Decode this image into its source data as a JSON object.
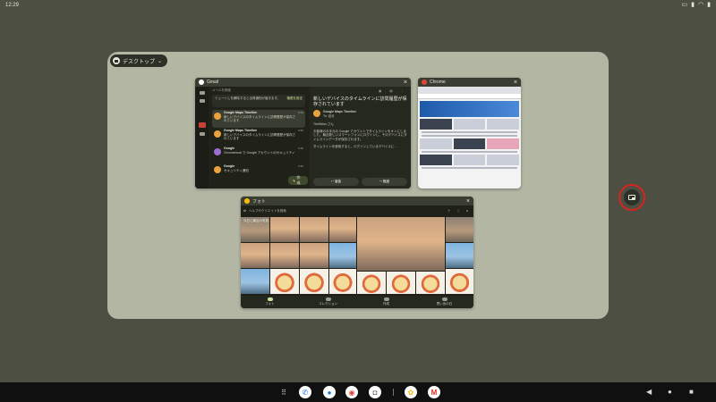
{
  "status_bar": {
    "time": "12:29",
    "icons": [
      "screen-record-icon",
      "battery-icon",
      "wifi-icon",
      "battery-level-icon"
    ]
  },
  "desk": {
    "label": "デスクトップ"
  },
  "windows": {
    "gmail": {
      "title": "Gmail",
      "search_hint": "メールを検索",
      "notice": "ミュートしを解除すると出荷通知が届きます。",
      "notice_action": "権限を設定",
      "items": [
        {
          "sender": "Google Maps Timeline",
          "snippet": "新しいデバイスのタイムラインに訪問履歴が保存されています",
          "time": "9:52",
          "color": "#e8a33a"
        },
        {
          "sender": "Google Maps Timeline",
          "snippet": "新しいデバイスのタイムラインに訪問履歴が保存されています",
          "time": "9:50",
          "color": "#e8a33a"
        },
        {
          "sender": "Google",
          "snippet": "Chromebook で Google アカウントのセキュリティ",
          "time": "9:48",
          "color": "#9b6fd2"
        },
        {
          "sender": "Google",
          "snippet": "セキュリティ通知",
          "time": "9:45",
          "color": "#e8a33a"
        }
      ],
      "compose": "作成",
      "subject": "新しいデバイスのタイムラインに訪問履歴が保存されています",
      "from": "Google Maps Timeline",
      "to": "To: 自分",
      "greeting": "TheWebs さん",
      "body1": "お客様のお手元の Google アカウントでタイムラインをオンにしました。最近新しいスマートフォンにログインし、そのデバイスにタイムラインデータが保存されます。",
      "body2": "タイムラインを使用すると、ログインしているデバイスに…",
      "reply": "返信",
      "forward": "転送"
    },
    "chrome": {
      "title": "Chrome"
    },
    "photos": {
      "title": "フォト",
      "search_hint": "ヘルプやクリエイトを検索",
      "date_label": "今日と最近の写真",
      "nav": [
        {
          "label": "フォト",
          "active": true
        },
        {
          "label": "コレクション",
          "active": false
        },
        {
          "label": "作成",
          "active": false
        },
        {
          "label": "思い出の日",
          "active": false
        }
      ]
    }
  },
  "taskbar": {
    "apps": [
      {
        "name": "launcher",
        "glyph": "⠿",
        "bg": "transparent",
        "fg": "#e6e6e6"
      },
      {
        "name": "phone",
        "glyph": "✆",
        "bg": "#ffffff",
        "fg": "#1a73e8"
      },
      {
        "name": "messages",
        "glyph": "●",
        "bg": "#ffffff",
        "fg": "#1a73e8"
      },
      {
        "name": "chrome",
        "glyph": "◉",
        "bg": "#ffffff",
        "fg": "#db4437"
      },
      {
        "name": "camera",
        "glyph": "◘",
        "bg": "#ffffff",
        "fg": "#5f6368"
      },
      {
        "name": "photos",
        "glyph": "✿",
        "bg": "#ffffff",
        "fg": "#fbbc05"
      },
      {
        "name": "gmail",
        "glyph": "M",
        "bg": "#ffffff",
        "fg": "#d93025"
      }
    ],
    "nav": {
      "back": "◀",
      "home": "●",
      "overview": "■"
    }
  }
}
